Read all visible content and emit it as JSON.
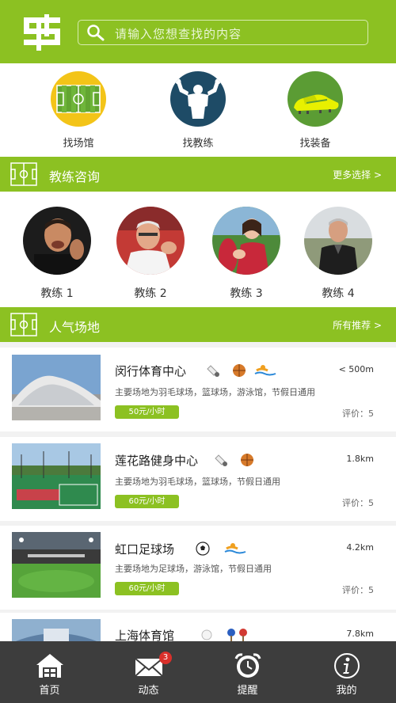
{
  "header": {
    "search_placeholder": "请输入您想查找的内容"
  },
  "categories": [
    {
      "label": "找场馆",
      "icon": "soccer-field-icon"
    },
    {
      "label": "找教练",
      "icon": "muscle-man-icon"
    },
    {
      "label": "找装备",
      "icon": "soccer-shoe-icon"
    }
  ],
  "coach_section": {
    "title": "教练咨询",
    "more": "更多选择 >",
    "coaches": [
      {
        "label": "教练 1"
      },
      {
        "label": "教练 2"
      },
      {
        "label": "教练 3"
      },
      {
        "label": "教练 4"
      }
    ]
  },
  "venue_section": {
    "title": "人气场地",
    "more": "所有推荐 >",
    "venues": [
      {
        "name": "闵行体育中心",
        "desc": "主要场地为羽毛球场，篮球场，游泳馆，节假日通用",
        "price": "50元/小时",
        "distance": "< 500m",
        "rating": "评价：5",
        "sports": [
          "badminton-icon",
          "basketball-icon",
          "swimming-icon"
        ]
      },
      {
        "name": "莲花路健身中心",
        "desc": "主要场地为羽毛球场，篮球场，节假日通用",
        "price": "60元/小时",
        "distance": "1.8km",
        "rating": "评价：5",
        "sports": [
          "badminton-icon",
          "basketball-icon"
        ]
      },
      {
        "name": "虹口足球场",
        "desc": "主要场地为足球场，游泳馆，节假日通用",
        "price": "60元/小时",
        "distance": "4.2km",
        "rating": "评价：5",
        "sports": [
          "soccer-ball-icon",
          "swimming-icon"
        ]
      },
      {
        "name": "上海体育馆",
        "distance": "7.8km",
        "sports": [
          "ping-pong-ball-icon",
          "ping-pong-paddle-icon"
        ]
      }
    ]
  },
  "tabbar": {
    "tabs": [
      {
        "label": "首页",
        "icon": "home-icon"
      },
      {
        "label": "动态",
        "icon": "mail-icon",
        "badge": "3"
      },
      {
        "label": "提醒",
        "icon": "alarm-clock-icon"
      },
      {
        "label": "我的",
        "icon": "info-icon"
      }
    ]
  },
  "colors": {
    "brand_green": "#8cc122",
    "tabbar_bg": "#3d3d3d",
    "badge_red": "#d9302b"
  }
}
